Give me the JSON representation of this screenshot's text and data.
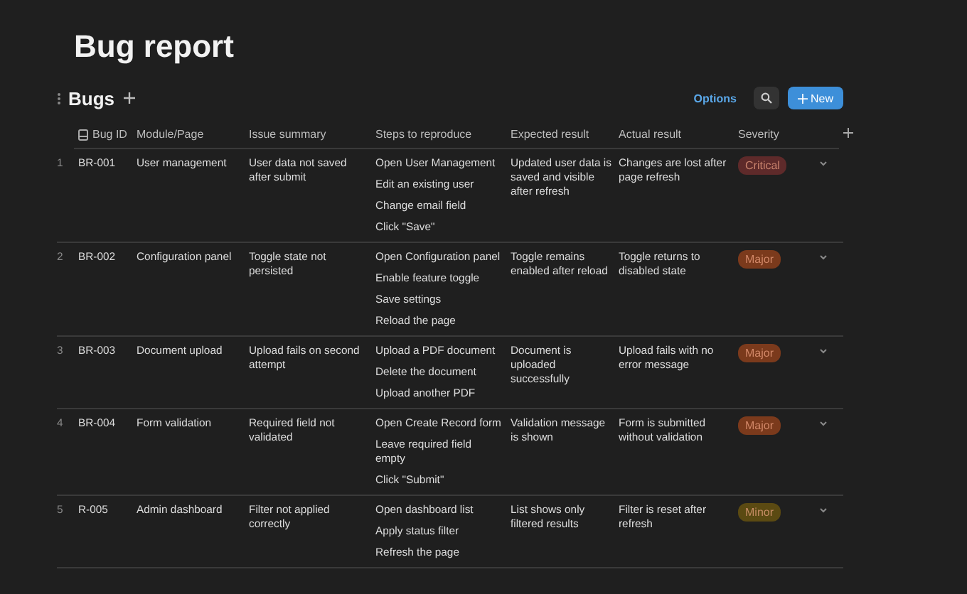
{
  "page": {
    "title": "Bug report"
  },
  "database": {
    "title": "Bugs",
    "options_label": "Options",
    "new_label": "New"
  },
  "table": {
    "columns": [
      "Bug ID",
      "Module/Page",
      "Issue summary",
      "Steps to reproduce",
      "Expected result",
      "Actual result",
      "Severity"
    ],
    "rows": [
      {
        "number": "1",
        "bug_id": "BR-001",
        "module": "User management",
        "summary": "User data not saved after submit",
        "steps": [
          "Open User Management",
          "Edit an existing user",
          "Change email field",
          "Click \"Save\""
        ],
        "expected": "Updated user data is saved and visible after refresh",
        "actual": "Changes are lost after page refresh",
        "severity": {
          "label": "Critical",
          "color": "#5e2a2a"
        }
      },
      {
        "number": "2",
        "bug_id": "BR-002",
        "module": "Configuration panel",
        "summary": "Toggle state not persisted",
        "steps": [
          "Open Configuration panel",
          "Enable feature toggle",
          "Save settings",
          "Reload the page"
        ],
        "expected": "Toggle remains enabled after reload",
        "actual": "Toggle returns to disabled state",
        "severity": {
          "label": "Major",
          "color": "#7b3a1c"
        }
      },
      {
        "number": "3",
        "bug_id": "BR-003",
        "module": "Document upload",
        "summary": "Upload fails on second attempt",
        "steps": [
          "Upload a PDF document",
          "Delete the document",
          "Upload another PDF"
        ],
        "expected": "Document is uploaded successfully",
        "actual": "Upload fails with no error message",
        "severity": {
          "label": "Major",
          "color": "#7b3a1c"
        }
      },
      {
        "number": "4",
        "bug_id": "BR-004",
        "module": "Form validation",
        "summary": "Required field not validated",
        "steps": [
          "Open Create Record form",
          "Leave required field empty",
          "Click \"Submit\""
        ],
        "expected": "Validation message is shown",
        "actual": "Form is submitted without validation",
        "severity": {
          "label": "Major",
          "color": "#7b3a1c"
        }
      },
      {
        "number": "5",
        "bug_id": "R-005",
        "module": "Admin dashboard",
        "summary": "Filter not applied correctly",
        "steps": [
          "Open dashboard list",
          "Apply status filter",
          "Refresh the page"
        ],
        "expected": "List shows only filtered results",
        "actual": "Filter is reset after refresh",
        "severity": {
          "label": "Minor",
          "color": "#5b4a12"
        }
      }
    ]
  }
}
